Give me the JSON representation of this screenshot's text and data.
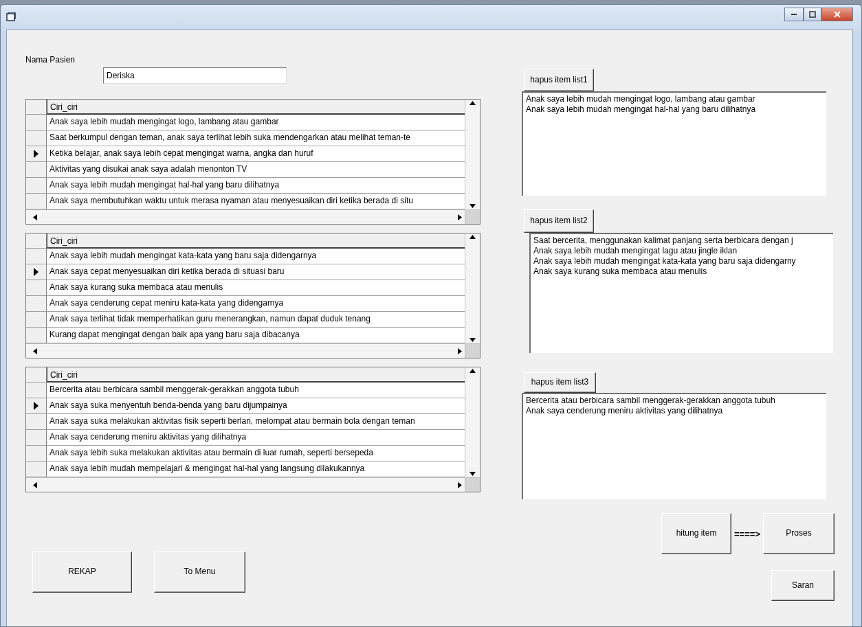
{
  "patient": {
    "label": "Nama Pasien",
    "value": "Deriska"
  },
  "grids": [
    {
      "column": "Ciri_ciri",
      "rows": [
        {
          "text": "Anak saya lebih mudah mengingat logo, lambang atau gambar",
          "selected": false
        },
        {
          "text": "Saat berkumpul dengan teman, anak saya terlihat lebih suka mendengarkan atau melihat teman-te",
          "selected": false
        },
        {
          "text": "Ketika belajar, anak saya lebih cepat mengingat warna, angka dan huruf",
          "selected": true
        },
        {
          "text": "Aktivitas yang disukai anak saya adalah menonton TV",
          "selected": false
        },
        {
          "text": "Anak saya lebih mudah mengingat hal-hal yang baru dilihatnya",
          "selected": false
        },
        {
          "text": "Anak saya membutuhkan waktu untuk merasa nyaman atau menyesuaikan diri ketika berada di situ",
          "selected": false
        }
      ]
    },
    {
      "column": "Ciri_ciri",
      "rows": [
        {
          "text": "Anak saya lebih mudah mengingat kata-kata yang baru saja didengarnya",
          "selected": false
        },
        {
          "text": "Anak saya cepat menyesuaikan diri ketika berada di situasi baru",
          "selected": true
        },
        {
          "text": "Anak saya kurang suka membaca atau menulis",
          "selected": false
        },
        {
          "text": "Anak saya cenderung cepat meniru kata-kata yang didengarnya",
          "selected": false
        },
        {
          "text": "Anak saya terlihat tidak memperhatikan guru menerangkan, namun dapat duduk tenang",
          "selected": false
        },
        {
          "text": "Kurang dapat mengingat dengan baik apa yang baru saja dibacanya",
          "selected": false
        }
      ]
    },
    {
      "column": "Ciri_ciri",
      "rows": [
        {
          "text": "Bercerita atau berbicara sambil menggerak-gerakkan anggota tubuh",
          "selected": false
        },
        {
          "text": "Anak saya suka menyentuh benda-benda yang baru dijumpainya",
          "selected": true
        },
        {
          "text": "Anak saya suka melakukan aktivitas fisik seperti berlari, melompat atau bermain bola dengan teman",
          "selected": false
        },
        {
          "text": "Anak saya cenderung meniru aktivitas yang dilihatnya",
          "selected": false
        },
        {
          "text": "Anak saya lebih suka melakukan aktivitas atau bermain di luar rumah, seperti bersepeda",
          "selected": false
        },
        {
          "text": "Anak saya lebih mudah mempelajari & mengingat hal-hal yang langsung dilakukannya",
          "selected": false
        }
      ]
    }
  ],
  "lists": [
    {
      "button": "hapus item list1",
      "items": [
        "Anak saya lebih mudah mengingat logo, lambang atau gambar",
        "Anak saya lebih mudah mengingat hal-hal yang baru dilihatnya"
      ]
    },
    {
      "button": "hapus item list2",
      "items": [
        "Saat bercerita, menggunakan kalimat panjang serta berbicara dengan j",
        "Anak saya lebih mudah mengingat lagu atau jingle iklan",
        "Anak saya lebih mudah mengingat kata-kata yang baru saja didengarny",
        "Anak saya kurang suka membaca atau menulis"
      ]
    },
    {
      "button": "hapus item list3",
      "items": [
        "Bercerita atau berbicara sambil menggerak-gerakkan anggota tubuh",
        "Anak saya cenderung meniru aktivitas yang dilihatnya"
      ]
    }
  ],
  "actions": {
    "count_button": "hitung item",
    "arrow": "====>",
    "process_button": "Proses",
    "advice_button": "Saran"
  },
  "bottom_buttons": [
    "REKAP",
    "To Menu"
  ]
}
